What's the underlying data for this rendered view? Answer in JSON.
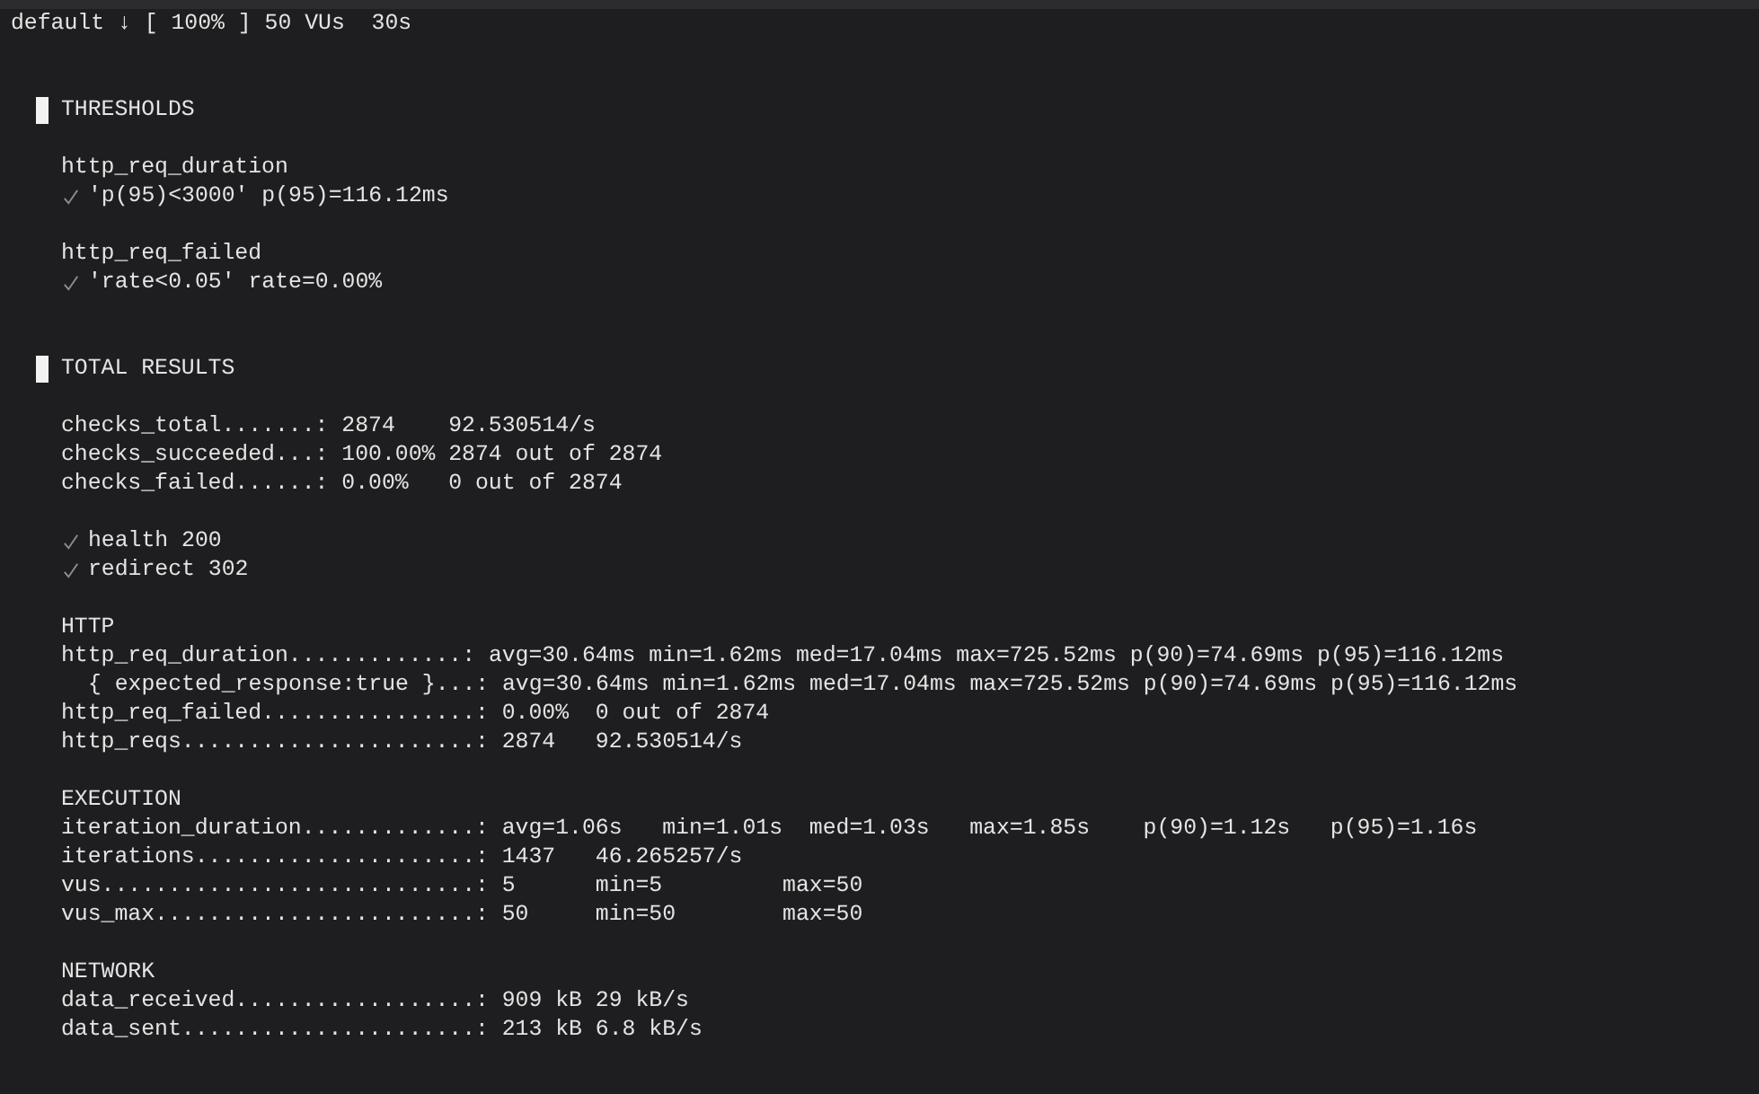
{
  "status_line": "default ↓ [ 100% ] 50 VUs  30s",
  "thresholds": {
    "heading": "THRESHOLDS",
    "metrics": [
      {
        "name": "http_req_duration",
        "checks": [
          {
            "passed": true,
            "text": "'p(95)<3000' p(95)=116.12ms"
          }
        ]
      },
      {
        "name": "http_req_failed",
        "checks": [
          {
            "passed": true,
            "text": "'rate<0.05' rate=0.00%"
          }
        ]
      }
    ]
  },
  "total_results": {
    "heading": "TOTAL RESULTS",
    "summary": [
      {
        "label": "checks_total.......:",
        "value": "2874    92.530514/s"
      },
      {
        "label": "checks_succeeded...:",
        "value": "100.00% 2874 out of 2874"
      },
      {
        "label": "checks_failed......:",
        "value": "0.00%   0 out of 2874"
      }
    ],
    "checks": [
      {
        "passed": true,
        "text": "health 200"
      },
      {
        "passed": true,
        "text": "redirect 302"
      }
    ],
    "groups": [
      {
        "heading": "HTTP",
        "rows": [
          {
            "label": "http_req_duration.............:",
            "value": "avg=30.64ms min=1.62ms med=17.04ms max=725.52ms p(90)=74.69ms p(95)=116.12ms",
            "children": [
              {
                "label": "{ expected_response:true }...:",
                "value": "avg=30.64ms min=1.62ms med=17.04ms max=725.52ms p(90)=74.69ms p(95)=116.12ms"
              }
            ]
          },
          {
            "label": "http_req_failed................:",
            "value": "0.00%  0 out of 2874"
          },
          {
            "label": "http_reqs......................:",
            "value": "2874   92.530514/s"
          }
        ]
      },
      {
        "heading": "EXECUTION",
        "rows": [
          {
            "label": "iteration_duration.............:",
            "value": "avg=1.06s   min=1.01s  med=1.03s   max=1.85s    p(90)=1.12s   p(95)=1.16s"
          },
          {
            "label": "iterations.....................:",
            "value": "1437   46.265257/s"
          },
          {
            "label": "vus............................:",
            "value": "5      min=5         max=50"
          },
          {
            "label": "vus_max........................:",
            "value": "50     min=50        max=50"
          }
        ]
      },
      {
        "heading": "NETWORK",
        "rows": [
          {
            "label": "data_received..................:",
            "value": "909 kB 29 kB/s"
          },
          {
            "label": "data_sent......................:",
            "value": "213 kB 6.8 kB/s"
          }
        ]
      }
    ]
  }
}
